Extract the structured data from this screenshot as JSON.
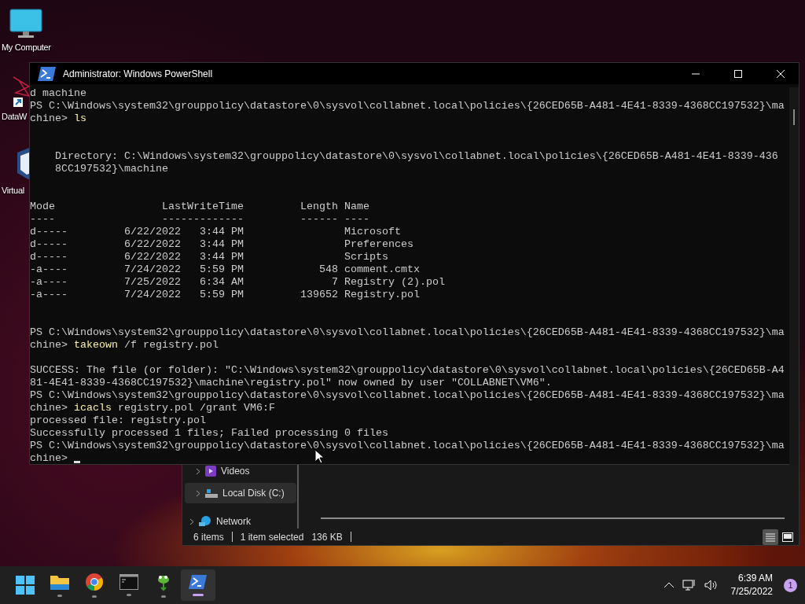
{
  "desktop": {
    "icons": [
      {
        "kind": "monitor",
        "label": "My Computer"
      },
      {
        "kind": "shortcut",
        "label": "DataW"
      },
      {
        "kind": "box",
        "label": "Virtual"
      }
    ]
  },
  "terminal": {
    "title": "Administrator: Windows PowerShell",
    "lines": [
      {
        "kind": "output",
        "text": "d machine"
      },
      {
        "kind": "output",
        "text": "PS C:\\Windows\\system32\\grouppolicy\\datastore\\0\\sysvol\\collabnet.local\\policies\\{26CED65B-A481-4E41-8339-4368CC197532}\\ma"
      },
      {
        "kind": "command",
        "prompt": "chine> ",
        "cmd": "ls"
      },
      {
        "kind": "blank"
      },
      {
        "kind": "blank"
      },
      {
        "kind": "output",
        "text": "    Directory: C:\\Windows\\system32\\grouppolicy\\datastore\\0\\sysvol\\collabnet.local\\policies\\{26CED65B-A481-4E41-8339-436"
      },
      {
        "kind": "output",
        "text": "    8CC197532}\\machine"
      },
      {
        "kind": "blank"
      },
      {
        "kind": "blank"
      },
      {
        "kind": "output",
        "text": "Mode                 LastWriteTime         Length Name"
      },
      {
        "kind": "output",
        "text": "----                 -------------         ------ ----"
      },
      {
        "kind": "output",
        "text": "d-----         6/22/2022   3:44 PM                Microsoft"
      },
      {
        "kind": "output",
        "text": "d-----         6/22/2022   3:44 PM                Preferences"
      },
      {
        "kind": "output",
        "text": "d-----         6/22/2022   3:44 PM                Scripts"
      },
      {
        "kind": "output",
        "text": "-a----         7/24/2022   5:59 PM            548 comment.cmtx"
      },
      {
        "kind": "output",
        "text": "-a----         7/25/2022   6:34 AM              7 Registry (2).pol"
      },
      {
        "kind": "output",
        "text": "-a----         7/24/2022   5:59 PM         139652 Registry.pol"
      },
      {
        "kind": "blank"
      },
      {
        "kind": "blank"
      },
      {
        "kind": "output",
        "text": "PS C:\\Windows\\system32\\grouppolicy\\datastore\\0\\sysvol\\collabnet.local\\policies\\{26CED65B-A481-4E41-8339-4368CC197532}\\ma"
      },
      {
        "kind": "command",
        "prompt": "chine> ",
        "cmd": "takeown",
        "args": " /f registry.pol"
      },
      {
        "kind": "blank"
      },
      {
        "kind": "output",
        "text": "SUCCESS: The file (or folder): \"C:\\Windows\\system32\\grouppolicy\\datastore\\0\\sysvol\\collabnet.local\\policies\\{26CED65B-A4"
      },
      {
        "kind": "output",
        "text": "81-4E41-8339-4368CC197532}\\machine\\registry.pol\" now owned by user \"COLLABNET\\VM6\"."
      },
      {
        "kind": "output",
        "text": "PS C:\\Windows\\system32\\grouppolicy\\datastore\\0\\sysvol\\collabnet.local\\policies\\{26CED65B-A481-4E41-8339-4368CC197532}\\ma"
      },
      {
        "kind": "command",
        "prompt": "chine> ",
        "cmd": "icacls",
        "args": " registry.pol /grant VM6:F"
      },
      {
        "kind": "output",
        "text": "processed file: registry.pol"
      },
      {
        "kind": "output",
        "text": "Successfully processed 1 files; Failed processing 0 files"
      },
      {
        "kind": "output",
        "text": "PS C:\\Windows\\system32\\grouppolicy\\datastore\\0\\sysvol\\collabnet.local\\policies\\{26CED65B-A481-4E41-8339-4368CC197532}\\ma"
      },
      {
        "kind": "input",
        "prompt": "chine> "
      }
    ]
  },
  "explorer": {
    "nav_items": [
      {
        "kind": "videos",
        "label": "Videos",
        "selected": false
      },
      {
        "kind": "drive",
        "label": "Local Disk (C:)",
        "selected": true
      },
      {
        "kind": "network",
        "label": "Network",
        "selected": false
      }
    ],
    "status_groups": [
      [
        "6 items"
      ],
      [
        "1 item selected",
        "136 KB"
      ]
    ],
    "view_buttons": [
      {
        "kind": "details",
        "selected": true
      },
      {
        "kind": "tiles",
        "selected": false
      }
    ]
  },
  "taskbar": {
    "apps": [
      {
        "kind": "start",
        "active": false
      },
      {
        "kind": "folder",
        "active": false
      },
      {
        "kind": "browser",
        "active": false
      },
      {
        "kind": "console",
        "active": false
      },
      {
        "kind": "gecko",
        "active": false
      },
      {
        "kind": "powershell",
        "active": true
      }
    ],
    "time": "6:39 AM",
    "date": "7/25/2022",
    "notifications": "1"
  }
}
